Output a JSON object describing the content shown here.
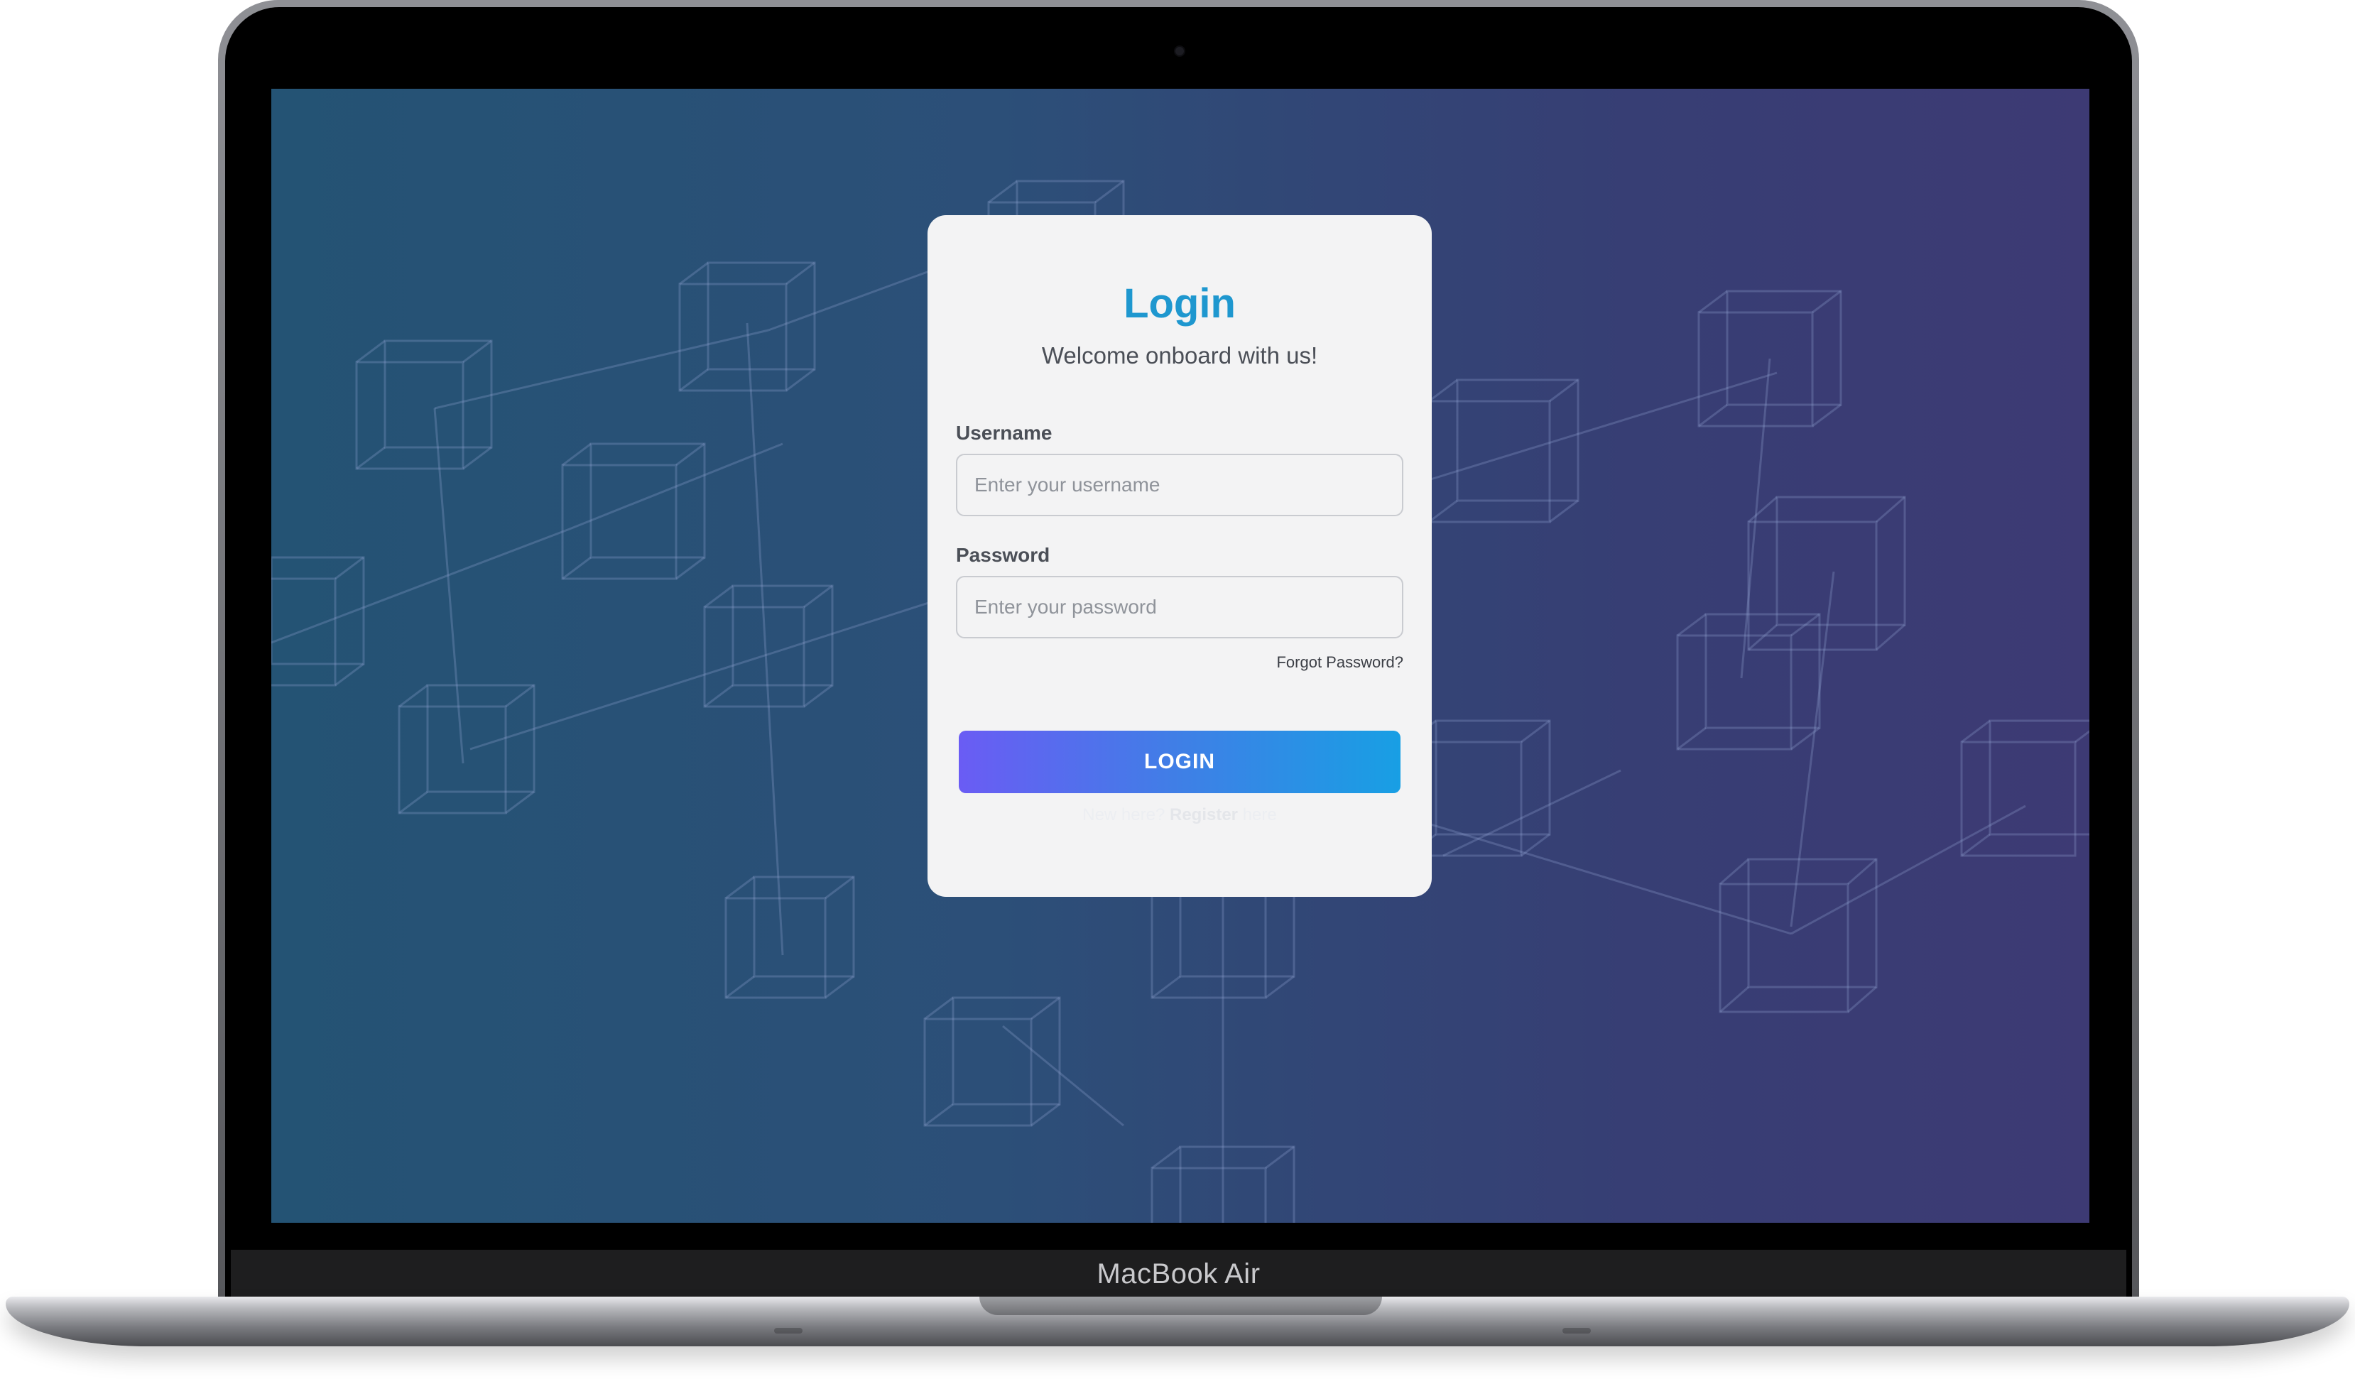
{
  "device": {
    "brand_label": "MacBook Air"
  },
  "login": {
    "title": "Login",
    "subtitle": "Welcome onboard with us!",
    "username": {
      "label": "Username",
      "placeholder": "Enter your username",
      "value": ""
    },
    "password": {
      "label": "Password",
      "placeholder": "Enter your password",
      "value": ""
    },
    "forgot_password": "Forgot Password?",
    "submit_label": "LOGIN",
    "register_prefix": "New here?",
    "register_link": "Register",
    "register_suffix": "here"
  },
  "colors": {
    "background_start": "#245374",
    "background_end": "#3d3a74",
    "card": "#f3f3f4",
    "title_accent": "#1e97cf",
    "button_start": "#6a5cf4",
    "button_end": "#189fe4"
  }
}
